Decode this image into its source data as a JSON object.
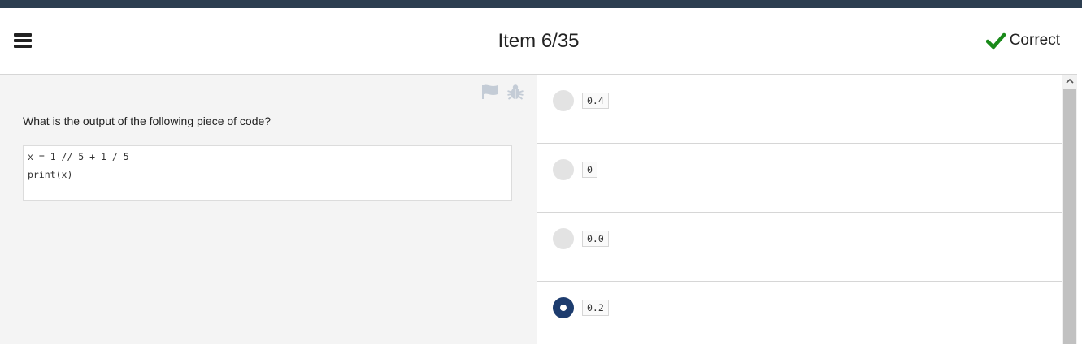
{
  "header": {
    "title": "Item 6/35",
    "status_label": "Correct",
    "status_color": "#1a8a1a",
    "menu_icon": "hamburger-menu-icon"
  },
  "toolbar": {
    "flag_icon": "flag-icon",
    "bug_icon": "bug-icon"
  },
  "question": {
    "text": "What is the output of the following piece of code?",
    "code_lines": [
      "x = 1 // 5 + 1 / 5",
      "print(x)"
    ]
  },
  "options": [
    {
      "value": "0.4",
      "selected": false
    },
    {
      "value": "0",
      "selected": false
    },
    {
      "value": "0.0",
      "selected": false
    },
    {
      "value": "0.2",
      "selected": true
    }
  ],
  "colors": {
    "topbar": "#2c3e50",
    "selected_radio": "#1d3c6e",
    "panel_background": "#f4f4f4"
  }
}
